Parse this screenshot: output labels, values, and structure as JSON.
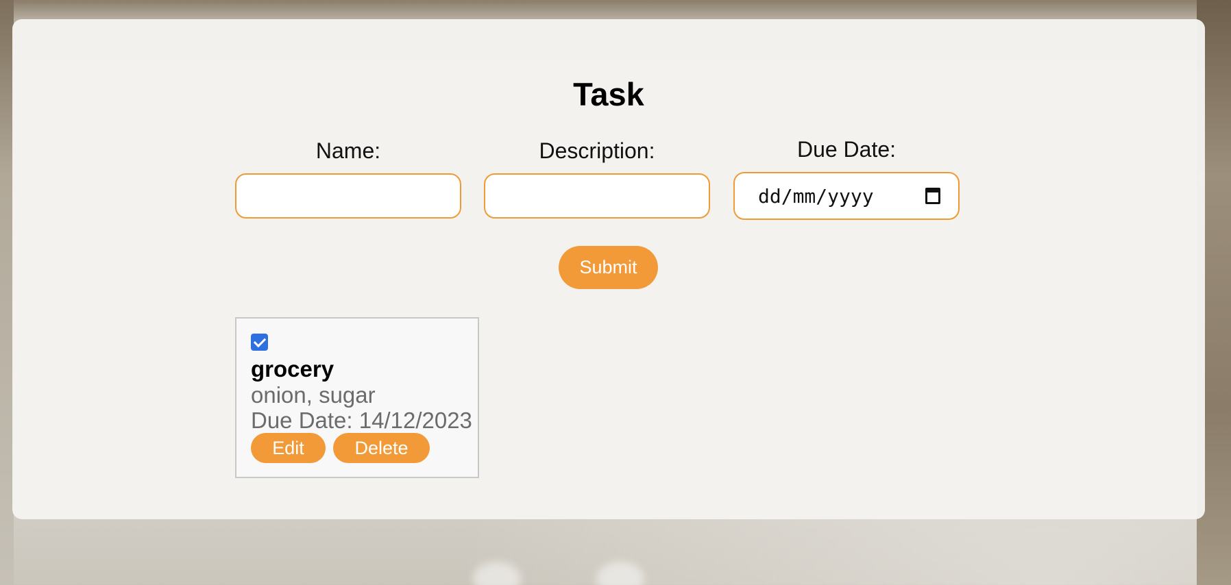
{
  "form": {
    "title": "Task",
    "name_label": "Name:",
    "name_value": "",
    "description_label": "Description:",
    "description_value": "",
    "due_date_label": "Due Date:",
    "due_date_placeholder": "dd/mm/yyyy",
    "submit_label": "Submit"
  },
  "tasks": [
    {
      "completed": true,
      "name": "grocery",
      "description": "onion, sugar",
      "due_date": "Due Date: 14/12/2023",
      "edit_label": "Edit",
      "delete_label": "Delete"
    }
  ],
  "colors": {
    "accent": "#f29a38",
    "checkbox": "#2f6fe0"
  },
  "icons": {
    "date_picker": "calendar-icon",
    "checkbox": "checkmark-icon"
  }
}
